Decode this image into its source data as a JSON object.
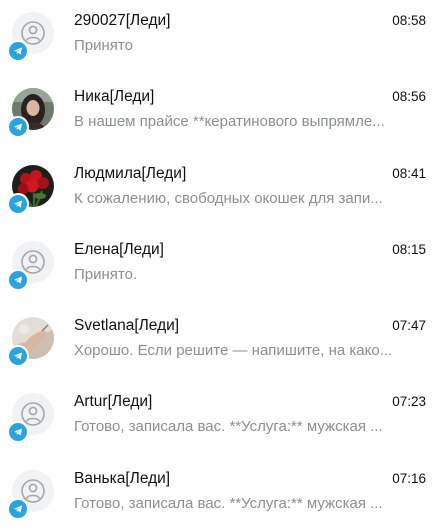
{
  "chats": [
    {
      "name": "290027[Леди]",
      "time": "08:58",
      "preview": "Принято",
      "avatar": "default-user-icon"
    },
    {
      "name": "Ника[Леди]",
      "time": "08:56",
      "preview": "В нашем прайсе **кератинового выпрямле...",
      "avatar": "photo-woman-dark-hair"
    },
    {
      "name": "Людмила[Леди]",
      "time": "08:41",
      "preview": "К сожалению, свободных окошек для запи...",
      "avatar": "photo-red-roses"
    },
    {
      "name": "Елена[Леди]",
      "time": "08:15",
      "preview": "Принято.",
      "avatar": "default-user-icon"
    },
    {
      "name": "Svetlana[Леди]",
      "time": "07:47",
      "preview": "Хорошо. Если решите — напишите, на како...",
      "avatar": "photo-hand-pastel"
    },
    {
      "name": "Artur[Леди]",
      "time": "07:23",
      "preview": "Готово, записала вас. **Услуга:** мужская ...",
      "avatar": "default-user-icon"
    },
    {
      "name": "Ванька[Леди]",
      "time": "07:16",
      "preview": "Готово, записала вас. **Услуга:** мужская ...",
      "avatar": "default-user-icon"
    }
  ],
  "colors": {
    "telegram_badge": "#2aa3e0",
    "preview_text": "#8b8f94",
    "name_text": "#111111",
    "avatar_placeholder_bg": "#f1f2f4"
  }
}
